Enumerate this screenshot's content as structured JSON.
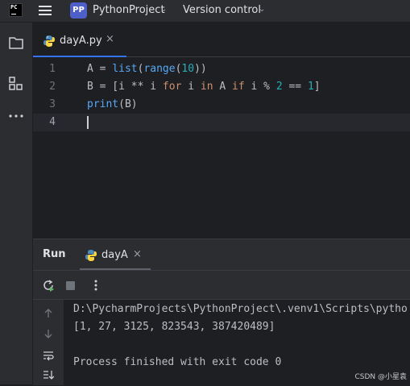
{
  "titlebar": {
    "logo_text": "PC",
    "project_badge": "PP",
    "project_name": "PythonProject",
    "vcs_label": "Version control"
  },
  "editor": {
    "tab_label": "dayA.py",
    "line_numbers": [
      "1",
      "2",
      "3",
      "4"
    ],
    "lines": [
      "A = list(range(10))",
      "B = [i ** i for i in A if i % 2 == 1]",
      "print(B)",
      ""
    ]
  },
  "run_panel": {
    "title": "Run",
    "tab_label": "dayA",
    "console": [
      "D:\\PycharmProjects\\PythonProject\\.venv1\\Scripts\\pytho",
      "[1, 27, 3125, 823543, 387420489]",
      "",
      "Process finished with exit code 0"
    ]
  },
  "watermark": "CSDN @小星袁",
  "colors": {
    "accent": "#3574f0",
    "project_badge": "#4e5fc9",
    "keyword": "#cf8e6d",
    "function": "#56a8f5",
    "number": "#2aacb8"
  },
  "icons": [
    "menu-icon",
    "folder-icon",
    "structure-icon",
    "more-icon",
    "python-file-icon",
    "close-icon",
    "rerun-icon",
    "stop-icon",
    "more-vertical-icon",
    "arrow-up-icon",
    "arrow-down-icon",
    "soft-wrap-icon",
    "scroll-to-end-icon"
  ]
}
